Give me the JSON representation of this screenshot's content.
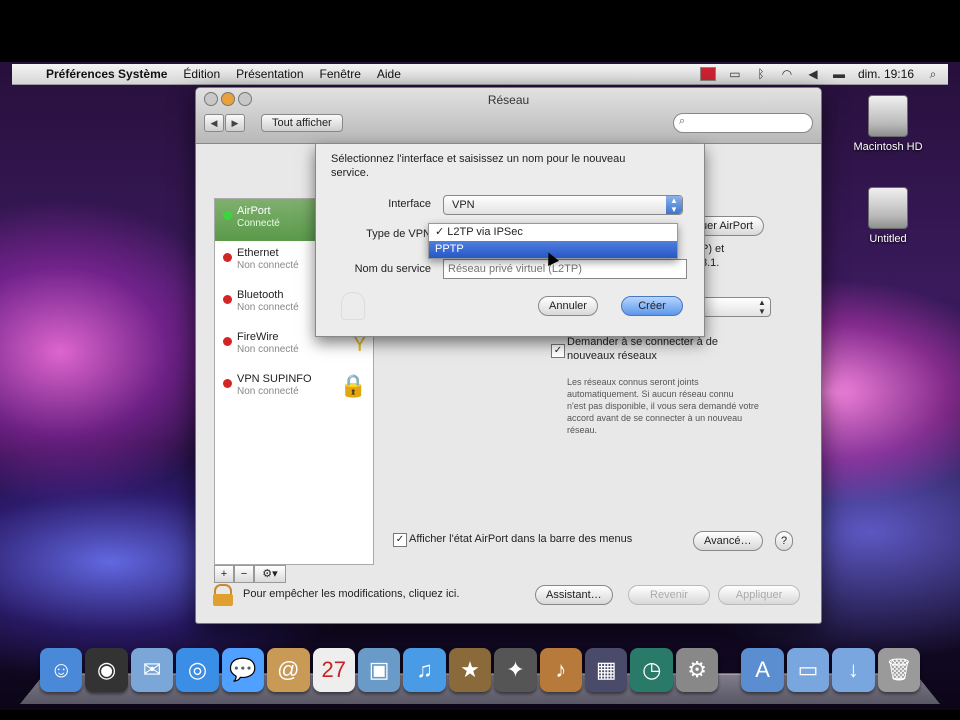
{
  "menubar": {
    "app_name": "Préférences Système",
    "menus": [
      "Édition",
      "Présentation",
      "Fenêtre",
      "Aide"
    ],
    "clock": "dim. 19:16"
  },
  "desktop": {
    "icons": [
      {
        "label": "Macintosh HD",
        "icon": "hard-disk-icon"
      },
      {
        "label": "Untitled",
        "icon": "hard-disk-icon"
      }
    ]
  },
  "window": {
    "title": "Réseau",
    "show_all": "Tout afficher",
    "search_placeholder": ""
  },
  "sidebar": {
    "services": [
      {
        "name": "AirPort",
        "status": "Connecté",
        "selected": true,
        "glyph": ""
      },
      {
        "name": "Ethernet",
        "status": "Non connecté",
        "selected": false,
        "glyph": ""
      },
      {
        "name": "Bluetooth",
        "status": "Non connecté",
        "selected": false,
        "glyph": ""
      },
      {
        "name": "FireWire",
        "status": "Non connecté",
        "selected": false,
        "glyph": "Y"
      },
      {
        "name": "VPN SUPINFO",
        "status": "Non connecté",
        "selected": false,
        "glyph": "🔒"
      }
    ],
    "tools": [
      "+",
      "−",
      "⚙▾"
    ]
  },
  "right_pane": {
    "turn_airport_button": "uer AirPort",
    "partial_text_1": "P) et",
    "partial_text_2": "8.1.",
    "ask_join_label_line1": "Demander à se connecter à de",
    "ask_join_label_line2": "nouveaux réseaux",
    "ask_join_desc": [
      "Les réseaux connus seront joints",
      "automatiquement. Si aucun réseau connu",
      "n'est pas disponible, il vous sera demandé votre",
      "accord avant de se connecter à un nouveau",
      "réseau."
    ],
    "show_airport_status": "Afficher l'état AirPort dans la barre des menus",
    "advanced_button": "Avancé…",
    "help_button": "?"
  },
  "footer": {
    "lock_text": "Pour empêcher les modifications, cliquez ici.",
    "assistant": "Assistant…",
    "revert": "Revenir",
    "apply": "Appliquer"
  },
  "sheet": {
    "prompt": "Sélectionnez l'interface et saisissez un nom pour le nouveau service.",
    "interface_label": "Interface",
    "interface_value": "VPN",
    "vpn_type_label": "Type de VPN",
    "service_name_label": "Nom du service",
    "service_name_value": "Réseau privé virtuel (L2TP)",
    "cancel": "Annuler",
    "create": "Créer"
  },
  "vpn_menu": {
    "items": [
      {
        "label": "✓ L2TP via IPSec",
        "highlighted": false
      },
      {
        "label": "PPTP",
        "highlighted": true
      }
    ]
  },
  "dock": {
    "items": [
      {
        "icon": "finder-icon",
        "color": "#4a88d8",
        "glyph": "☺"
      },
      {
        "icon": "dashboard-icon",
        "color": "#333333",
        "glyph": "◉"
      },
      {
        "icon": "mail-icon",
        "color": "#7aa6d8",
        "glyph": "✉"
      },
      {
        "icon": "safari-icon",
        "color": "#3a8ee6",
        "glyph": "◎"
      },
      {
        "icon": "ichat-icon",
        "color": "#4fa0ff",
        "glyph": "💬"
      },
      {
        "icon": "address-book-icon",
        "color": "#c99a55",
        "glyph": "@"
      },
      {
        "icon": "ical-icon",
        "color": "#eeeeee",
        "glyph": "27"
      },
      {
        "icon": "iphoto-icon",
        "color": "#6a9bc8",
        "glyph": "▣"
      },
      {
        "icon": "itunes-icon",
        "color": "#4a9be6",
        "glyph": "♫"
      },
      {
        "icon": "imovie-icon",
        "color": "#8a6a3a",
        "glyph": "★"
      },
      {
        "icon": "front-row-icon",
        "color": "#555555",
        "glyph": "✦"
      },
      {
        "icon": "garageband-icon",
        "color": "#b87a3a",
        "glyph": "♪"
      },
      {
        "icon": "spaces-icon",
        "color": "#4a4a6a",
        "glyph": "▦"
      },
      {
        "icon": "time-machine-icon",
        "color": "#2a7a6a",
        "glyph": "◷"
      },
      {
        "icon": "system-preferences-icon",
        "color": "#888888",
        "glyph": "⚙"
      },
      {
        "icon": "applications-folder-icon",
        "color": "#5a8ed0",
        "glyph": "A"
      },
      {
        "icon": "documents-folder-icon",
        "color": "#7aa6e0",
        "glyph": "▭"
      },
      {
        "icon": "downloads-folder-icon",
        "color": "#7aa6e0",
        "glyph": "↓"
      },
      {
        "icon": "trash-icon",
        "color": "#9a9a9a",
        "glyph": "🗑"
      }
    ]
  }
}
